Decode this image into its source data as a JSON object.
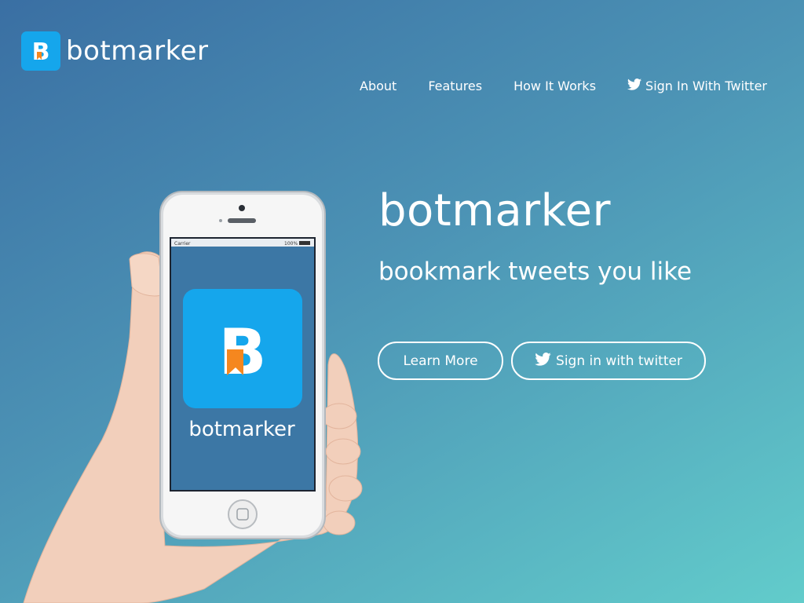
{
  "brand": {
    "name": "botmarker",
    "logo_letter": "B",
    "logo_color": "#15a6ec",
    "logo_accent": "#f5871f"
  },
  "nav": {
    "items": [
      {
        "label": "About"
      },
      {
        "label": "Features"
      },
      {
        "label": "How It Works"
      },
      {
        "label": "Sign In With Twitter",
        "icon": "twitter-bird-icon"
      }
    ]
  },
  "hero": {
    "title": "botmarker",
    "tagline": "bookmark tweets you like",
    "buttons": {
      "learn_more": "Learn More",
      "sign_in": "Sign in with twitter"
    }
  },
  "phone": {
    "status_carrier": "Carrier",
    "status_battery": "100%",
    "app_name": "botmarker",
    "screen_color": "#3c77a5"
  },
  "theme": {
    "gradient_start": "#3a6fa3",
    "gradient_end": "#62cccb",
    "text": "#ffffff"
  }
}
